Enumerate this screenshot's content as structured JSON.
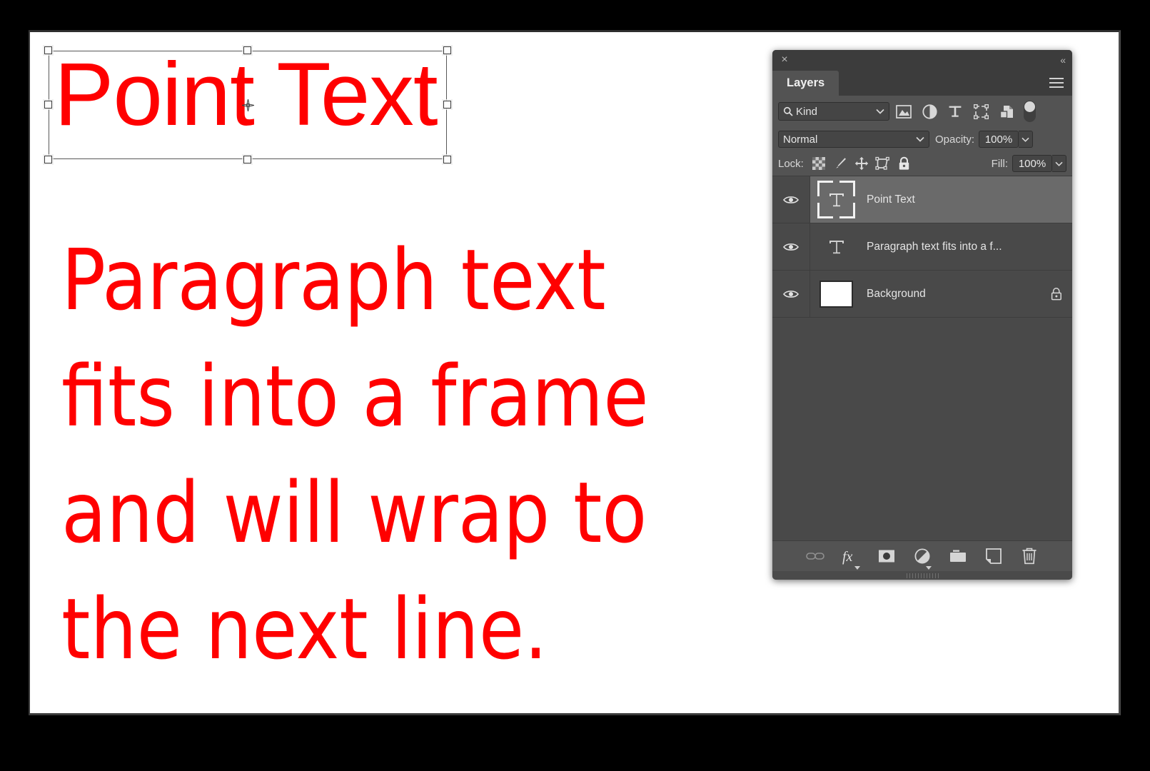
{
  "canvas": {
    "point_text": {
      "content": "Point Text",
      "color": "#ff0000"
    },
    "paragraph_text": {
      "color": "#ff0000",
      "lines": [
        "Paragraph text",
        "fits into a frame",
        "and will wrap to",
        "the next line."
      ]
    }
  },
  "panel": {
    "titlebar": {
      "close_label": "×",
      "collapse_label": "«"
    },
    "tabs": [
      {
        "label": "Layers",
        "active": true
      }
    ],
    "filter_row": {
      "kind_label": "Kind",
      "icons": [
        "pixel-layer-filter-icon",
        "adjustment-layer-filter-icon",
        "type-layer-filter-icon",
        "shape-layer-filter-icon",
        "smart-object-filter-icon"
      ],
      "toggle_on": true
    },
    "blend_row": {
      "blend_mode": "Normal",
      "opacity_label": "Opacity:",
      "opacity_value": "100%"
    },
    "lock_row": {
      "lock_label": "Lock:",
      "lock_icons": [
        "lock-transparent-pixels-icon",
        "lock-image-pixels-icon",
        "lock-position-icon",
        "lock-artboard-nesting-icon",
        "lock-all-icon"
      ],
      "fill_label": "Fill:",
      "fill_value": "100%"
    },
    "layers": [
      {
        "name": "Point Text",
        "thumb": "type",
        "selected": true,
        "visible": true,
        "locked": false
      },
      {
        "name": "Paragraph text fits into a f...",
        "thumb": "type",
        "selected": false,
        "visible": true,
        "locked": false
      },
      {
        "name": "Background",
        "thumb": "white",
        "selected": false,
        "visible": true,
        "locked": true
      }
    ],
    "bottom_icons": [
      "link-layers-icon",
      "layer-style-fx-icon",
      "add-layer-mask-icon",
      "new-adjustment-layer-icon",
      "new-group-icon",
      "new-layer-icon",
      "delete-layer-icon"
    ]
  },
  "colors": {
    "text_red": "#ff0000",
    "panel_bg": "#535353",
    "panel_list_bg": "#494949",
    "panel_titlebar": "#3c3c3c",
    "selected_row": "#6a6a6a",
    "frame_black": "#000000"
  }
}
